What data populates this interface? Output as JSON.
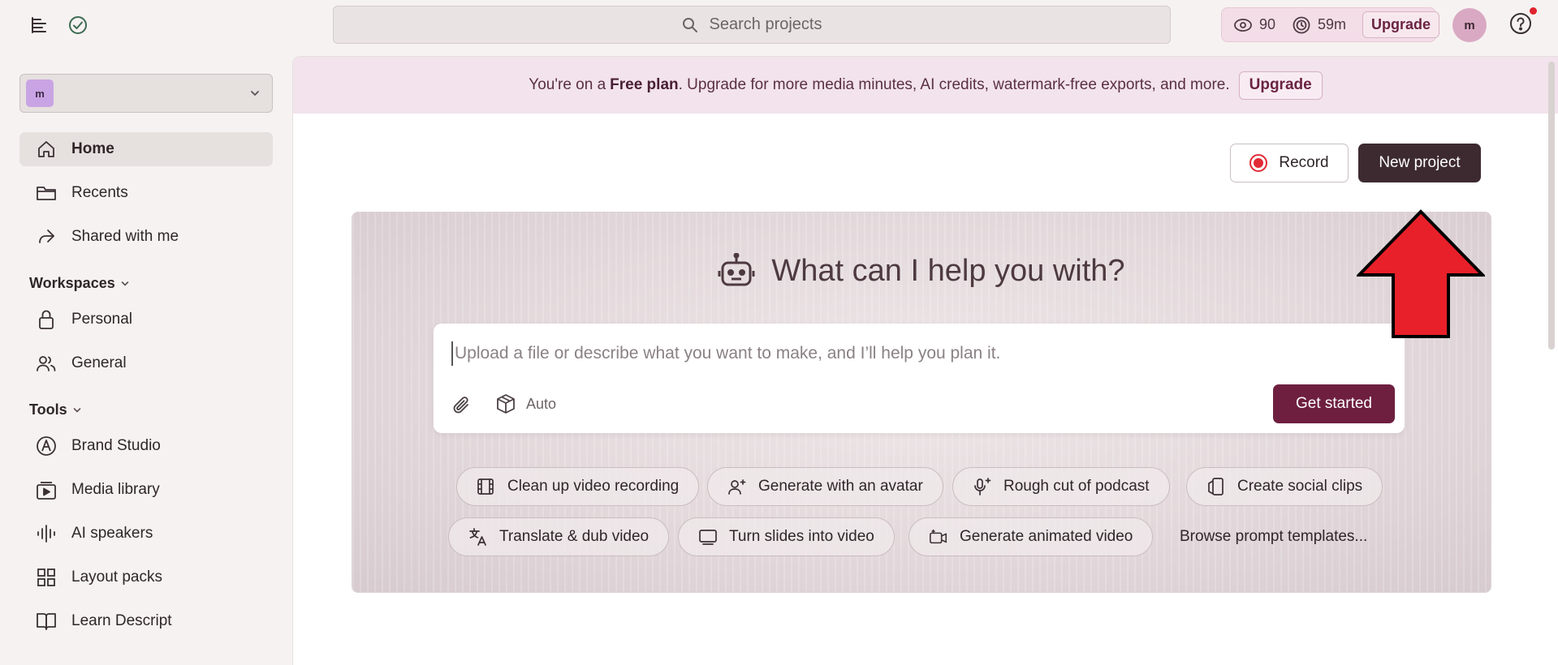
{
  "topbar": {
    "search_placeholder": "Search projects",
    "credits": {
      "ai_credits": "90",
      "media_minutes": "59m",
      "upgrade_label": "Upgrade"
    },
    "avatar_initial": "m"
  },
  "sidebar": {
    "workspace_initial": "m",
    "nav": [
      {
        "label": "Home",
        "icon": "home-icon",
        "active": true
      },
      {
        "label": "Recents",
        "icon": "folder-icon"
      },
      {
        "label": "Shared with me",
        "icon": "share-arrow-icon"
      }
    ],
    "workspaces_label": "Workspaces",
    "workspaces": [
      {
        "label": "Personal",
        "icon": "lock-icon"
      },
      {
        "label": "General",
        "icon": "users-icon"
      }
    ],
    "tools_label": "Tools",
    "tools": [
      {
        "label": "Brand Studio",
        "icon": "brand-icon"
      },
      {
        "label": "Media library",
        "icon": "media-library-icon"
      },
      {
        "label": "AI speakers",
        "icon": "waveform-icon"
      },
      {
        "label": "Layout packs",
        "icon": "grid-icon"
      },
      {
        "label": "Learn Descript",
        "icon": "book-icon"
      }
    ]
  },
  "banner": {
    "prefix": "You're on a",
    "plan": "Free plan",
    "suffix": ". Upgrade for more media minutes, AI credits, watermark-free exports, and more.",
    "upgrade_label": "Upgrade"
  },
  "actions": {
    "record_label": "Record",
    "new_project_label": "New project"
  },
  "hero": {
    "title": "What can I help you with?",
    "placeholder": "Upload a file or describe what you want to make, and I’ll help you plan it.",
    "model_label": "Auto",
    "get_started_label": "Get started",
    "chips_row1": [
      {
        "label": "Clean up video recording",
        "icon": "film-icon"
      },
      {
        "label": "Generate with an avatar",
        "icon": "avatar-sparkle-icon"
      },
      {
        "label": "Rough cut of podcast",
        "icon": "mic-sparkle-icon"
      },
      {
        "label": "Create social clips",
        "icon": "social-clip-icon"
      }
    ],
    "chips_row2": [
      {
        "label": "Translate & dub video",
        "icon": "translate-icon"
      },
      {
        "label": "Turn slides into video",
        "icon": "slides-icon"
      },
      {
        "label": "Generate animated video",
        "icon": "animated-video-icon"
      }
    ],
    "browse_label": "Browse prompt templates..."
  },
  "colors": {
    "accent": "#6e1f3f",
    "primary_dark": "#3d2a31",
    "banner_bg": "#f2e3ec",
    "annotation_arrow": "#e8202a"
  }
}
